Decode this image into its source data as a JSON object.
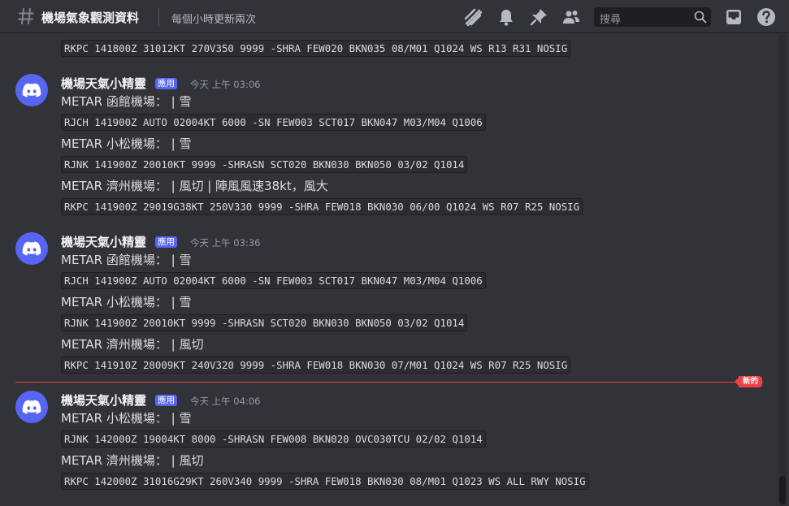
{
  "header": {
    "channel_name": "機場氣象觀測資料",
    "topic": "每個小時更新兩次",
    "search_placeholder": "搜尋"
  },
  "messages": {
    "top_code": "RKPC 141800Z 31012KT 270V350 9999 -SHRA FEW020 BKN035 08/M01 Q1024 WS R13 R31 NOSIG",
    "m1": {
      "author": "機場天氣小精靈",
      "badge": "應用",
      "time": "今天 上午 03:06",
      "l1": "METAR 函館機場： | 雪",
      "c1": "RJCH 141900Z AUTO 02004KT 6000 -SN FEW003 SCT017 BKN047 M03/M04 Q1006",
      "l2": "METAR 小松機場： | 雪",
      "c2": "RJNK 141900Z 20010KT 9999 -SHRASN SCT020 BKN030 BKN050 03/02 Q1014",
      "l3": "METAR 濟州機場： | 風切 | 陣風風速38kt，風大",
      "c3": "RKPC 141900Z 29019G38KT 250V330 9999 -SHRA FEW018 BKN030 06/00 Q1024 WS R07 R25 NOSIG"
    },
    "m2": {
      "author": "機場天氣小精靈",
      "badge": "應用",
      "time": "今天 上午 03:36",
      "l1": "METAR 函館機場： | 雪",
      "c1": "RJCH 141900Z AUTO 02004KT 6000 -SN FEW003 SCT017 BKN047 M03/M04 Q1006",
      "l2": "METAR 小松機場： | 雪",
      "c2": "RJNK 141900Z 20010KT 9999 -SHRASN SCT020 BKN030 BKN050 03/02 Q1014",
      "l3": "METAR 濟州機場： | 風切",
      "c3": "RKPC 141910Z 28009KT 240V320 9999 -SHRA FEW018 BKN030 07/M01 Q1024 WS R07 R25 NOSIG"
    },
    "new_label": "新的",
    "m3": {
      "author": "機場天氣小精靈",
      "badge": "應用",
      "time": "今天 上午 04:06",
      "l1": "METAR 小松機場： | 雪",
      "c1": "RJNK 142000Z 19004KT 8000 -SHRASN FEW008 BKN020 OVC030TCU 02/02 Q1014",
      "l2": "METAR 濟州機場： | 風切",
      "c2": "RKPC 142000Z 31016G29KT 260V340 9999 -SHRA FEW018 BKN030 08/M01 Q1023 WS ALL RWY NOSIG"
    }
  },
  "icons": [
    "hash-icon",
    "threads-icon",
    "bell-icon",
    "pin-icon",
    "members-icon",
    "search-icon",
    "inbox-icon",
    "help-icon",
    "discord-logo-icon"
  ],
  "colors": {
    "background": "#313338",
    "blurple": "#5865f2",
    "new_red": "#f23f43"
  }
}
